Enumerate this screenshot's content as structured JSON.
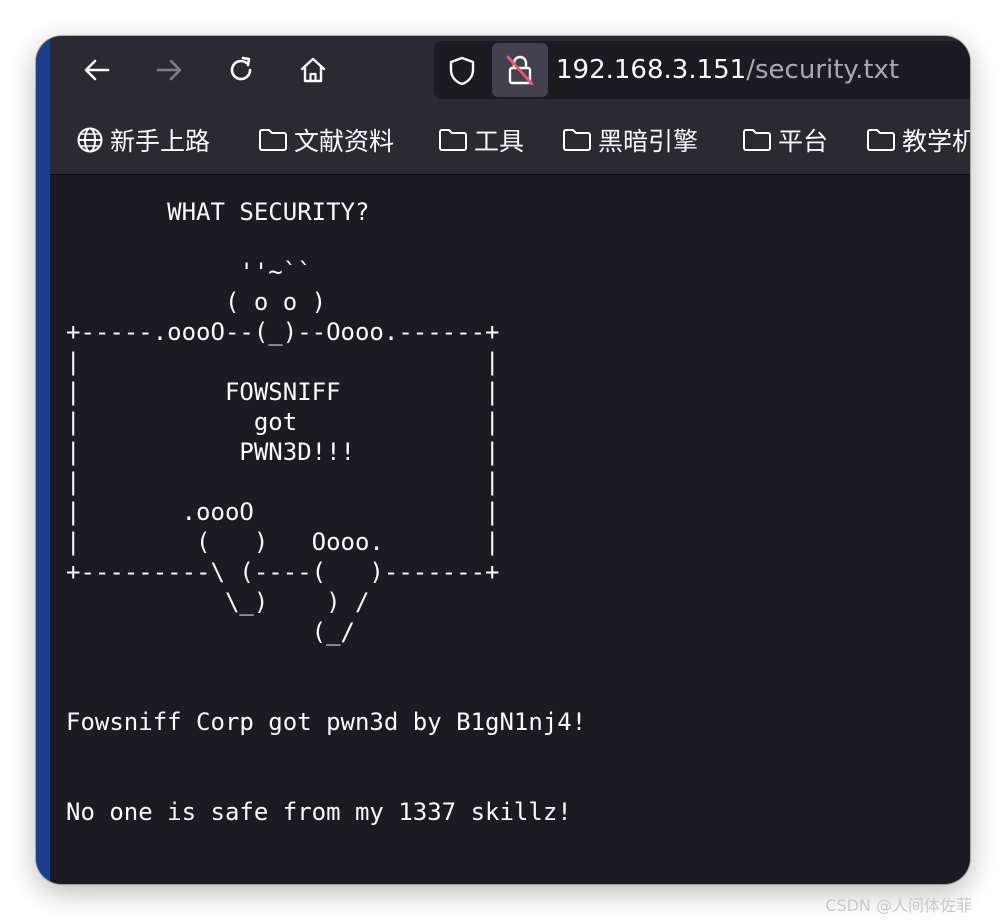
{
  "browser": {
    "url_host": "192.168.3.151",
    "url_path": "/security.txt",
    "accent_color": "#1a3f8f",
    "nav_icons": [
      "back-arrow-icon",
      "forward-arrow-icon",
      "reload-icon",
      "home-icon"
    ]
  },
  "bookmarks": [
    {
      "label": "新手上路",
      "icon": "globe-icon"
    },
    {
      "label": "文献资料",
      "icon": "folder-icon"
    },
    {
      "label": "工具",
      "icon": "folder-icon"
    },
    {
      "label": "黑暗引擎",
      "icon": "folder-icon"
    },
    {
      "label": "平台",
      "icon": "folder-icon"
    },
    {
      "label": "教学机",
      "icon": "folder-icon"
    }
  ],
  "page": {
    "text": "       WHAT SECURITY?\n\n            ''~``\n           ( o o )\n+-----.oooO--(_)--Oooo.------+\n|                            |\n|          FOWSNIFF          |\n|            got             |\n|           PWN3D!!!         |\n|                            |\n|       .oooO                |\n|        (   )   Oooo.       |\n+---------\\ (----(   )-------+\n           \\_)    ) /\n                 (_/\n\n\nFowsniff Corp got pwn3d by B1gN1nj4!\n\n\nNo one is safe from my 1337 skillz!"
  },
  "watermark": "CSDN @人间体佐菲"
}
